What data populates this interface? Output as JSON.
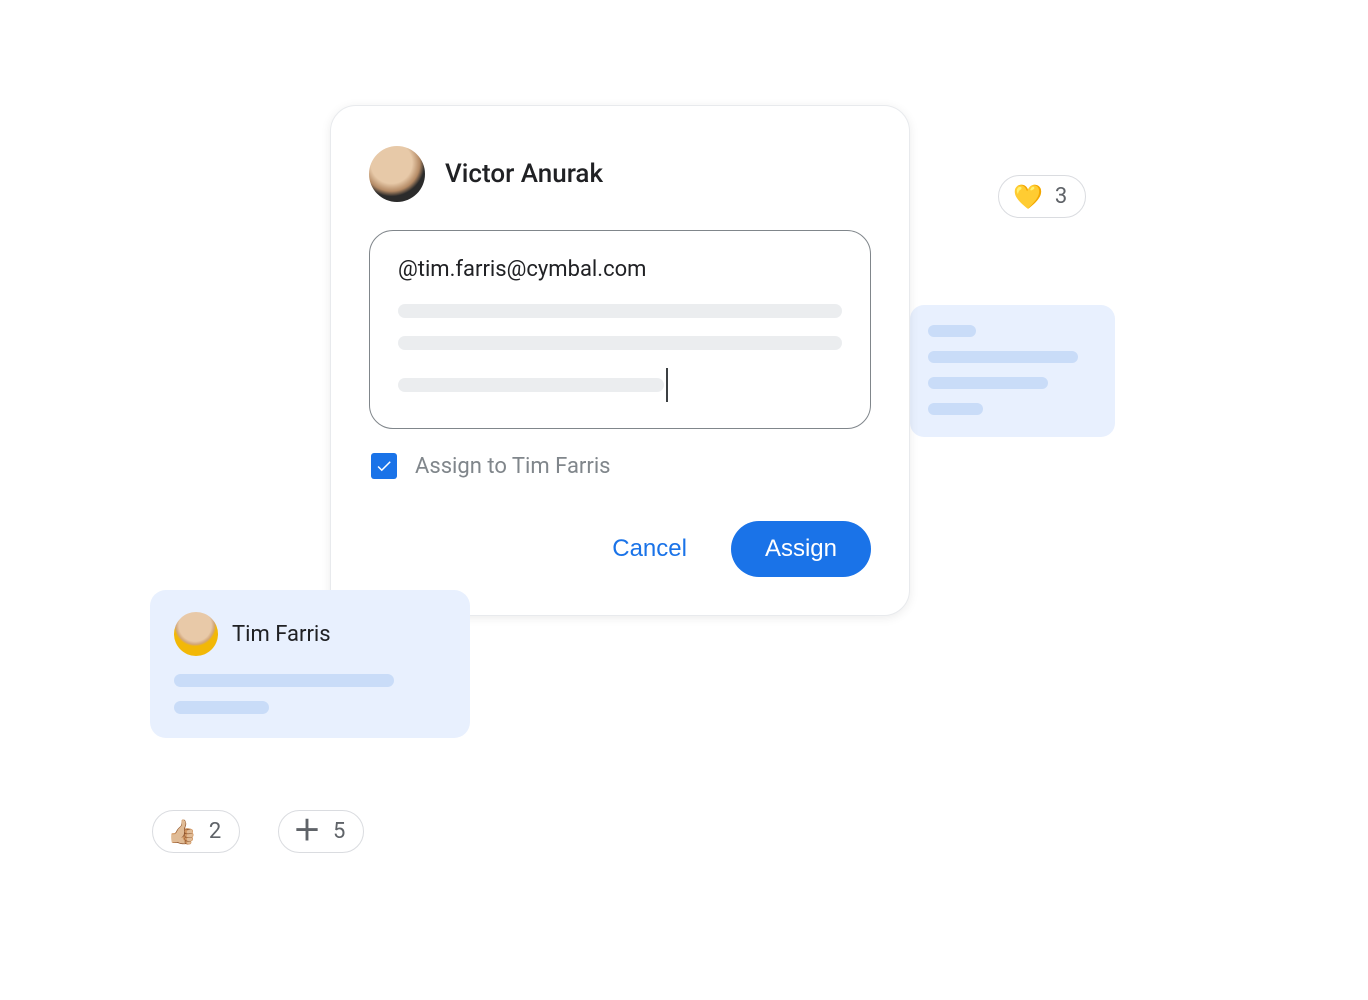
{
  "comment": {
    "author": "Victor Anurak",
    "mention_text": "@tim.farris@cymbal.com",
    "assign_checked": true,
    "assign_label": "Assign to Tim Farris",
    "cancel_label": "Cancel",
    "assign_button_label": "Assign"
  },
  "mini_card": {
    "name": "Tim Farris"
  },
  "reactions": {
    "heart": {
      "emoji": "💛",
      "count": "3"
    },
    "thumbs": {
      "emoji": "👍🏼",
      "count": "2"
    },
    "plus": {
      "count": "5"
    }
  }
}
